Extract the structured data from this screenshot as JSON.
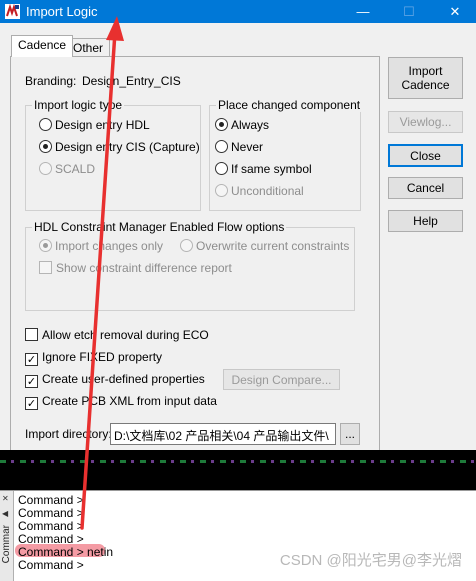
{
  "window": {
    "title": "Import Logic",
    "minimize_glyph": "—",
    "maximize_glyph": "☐",
    "close_glyph": "✕"
  },
  "tabs": [
    {
      "label": "Cadence",
      "active": true
    },
    {
      "label": "Other",
      "active": false
    }
  ],
  "branding": {
    "label": "Branding:",
    "value": "Design_Entry_CIS"
  },
  "import_logic_type": {
    "title": "Import logic type",
    "options": [
      {
        "label": "Design entry HDL",
        "selected": false,
        "enabled": true
      },
      {
        "label": "Design entry CIS (Capture)",
        "selected": true,
        "enabled": true
      },
      {
        "label": "SCALD",
        "selected": false,
        "enabled": false
      }
    ]
  },
  "place_changed": {
    "title": "Place changed component",
    "options": [
      {
        "label": "Always",
        "selected": true,
        "enabled": true
      },
      {
        "label": "Never",
        "selected": false,
        "enabled": true
      },
      {
        "label": "If same symbol",
        "selected": false,
        "enabled": true
      },
      {
        "label": "Unconditional",
        "selected": false,
        "enabled": false
      }
    ]
  },
  "hdl_constraint": {
    "title": "HDL Constraint Manager Enabled Flow options",
    "import_changes_only": "Import changes only",
    "overwrite_constraints": "Overwrite current constraints",
    "show_difference": "Show constraint difference report"
  },
  "checkboxes": [
    {
      "label": "Allow etch removal during ECO",
      "checked": false
    },
    {
      "label": "Ignore FIXED property",
      "checked": true
    },
    {
      "label": "Create user-defined properties",
      "checked": true
    },
    {
      "label": "Create PCB XML from input data",
      "checked": true
    }
  ],
  "design_compare_button": "Design Compare...",
  "import_directory": {
    "label": "Import directory:",
    "value": "D:\\文档库\\02 产品相关\\04 产品输出文件\\",
    "browse_label": "..."
  },
  "buttons": {
    "import_cadence": "Import Cadence",
    "viewlog": "Viewlog...",
    "close": "Close",
    "cancel": "Cancel",
    "help": "Help"
  },
  "command_window": {
    "side_label": "Commar",
    "lines": [
      "Command >",
      "Command >",
      "Command >",
      "Command >",
      "Command > netin",
      "Command >"
    ]
  },
  "watermark": "CSDN @阳光宅男@李光熠",
  "colors": {
    "titlebar": "#0078d7",
    "focus": "#0078d7",
    "annotation_arrow": "#e8302f",
    "highlight": "#f28a94"
  }
}
